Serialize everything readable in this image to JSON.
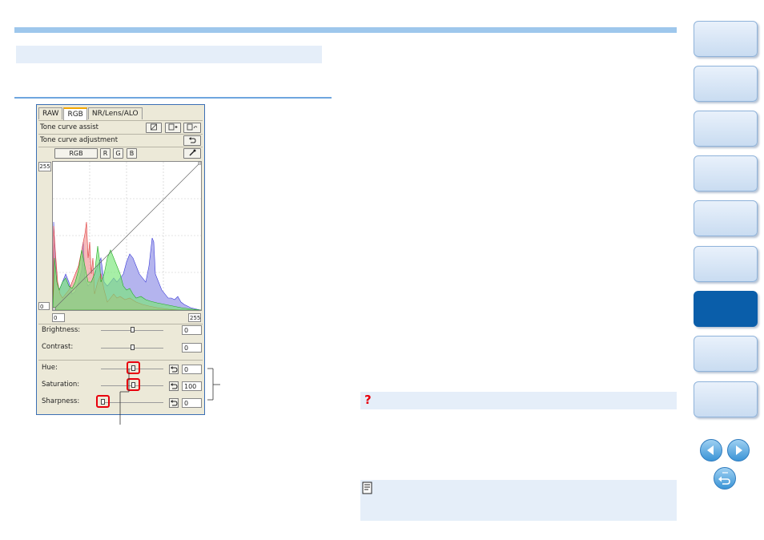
{
  "panel": {
    "tabs": [
      {
        "label": "RAW"
      },
      {
        "label": "RGB"
      },
      {
        "label": "NR/Lens/ALO"
      }
    ],
    "tone_curve_assist_label": "Tone curve assist",
    "tone_curve_adjustment_label": "Tone curve adjustment",
    "channel_buttons": [
      {
        "label": "RGB"
      },
      {
        "label": "R"
      },
      {
        "label": "G"
      },
      {
        "label": "B"
      }
    ],
    "graph": {
      "y_max_label": "255",
      "y_min_label": "0",
      "x_min_value": "0",
      "x_max_value": "255"
    },
    "sliders": [
      {
        "label": "Brightness:",
        "value": "0",
        "level": 0.5,
        "resettable": false
      },
      {
        "label": "Contrast:",
        "value": "0",
        "level": 0.5,
        "resettable": false
      },
      {
        "label": "Hue:",
        "value": "0",
        "level": 0.5,
        "resettable": true
      },
      {
        "label": "Saturation:",
        "value": "100",
        "level": 0.5,
        "resettable": true
      },
      {
        "label": "Sharpness:",
        "value": "0",
        "level": 0.0,
        "resettable": true
      }
    ]
  },
  "question_icon": "?",
  "colors": {
    "accent_blue": "#9ec7ec",
    "highlight_red": "#e8000c",
    "nav_active": "#0a5eaa",
    "panel_bg": "#ece9d8"
  },
  "icons": [
    "edit-curve-icon",
    "add-point-icon",
    "reset-curve-icon",
    "undo-icon",
    "eyedropper-icon",
    "memo-icon",
    "prev-arrow-icon",
    "next-arrow-icon",
    "return-icon"
  ]
}
